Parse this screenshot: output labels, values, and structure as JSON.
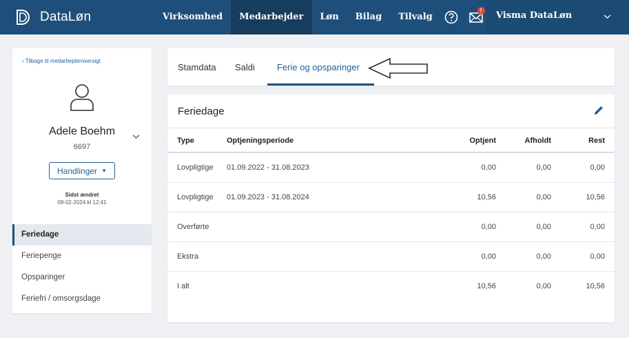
{
  "app": {
    "logo_text": "DataLøn",
    "nav": [
      {
        "label": "Virksomhed"
      },
      {
        "label": "Medarbejder"
      },
      {
        "label": "Løn"
      },
      {
        "label": "Bilag"
      },
      {
        "label": "Tilvalg"
      }
    ],
    "active_nav": "Medarbejder",
    "mail_badge": "!",
    "account_name": "Visma DataLøn"
  },
  "sidebar": {
    "back_link": "Tilbage til medarbejderoversigt",
    "employee_name": "Adele Boehm",
    "employee_number": "6697",
    "actions_label": "Handlinger",
    "changed_label": "Sidst ændret",
    "changed_value": "09-02-2024 kl 12:41",
    "menu": [
      {
        "label": "Feriedage"
      },
      {
        "label": "Feriepenge"
      },
      {
        "label": "Opsparinger"
      },
      {
        "label": "Feriefri / omsorgsdage"
      }
    ],
    "active_menu": "Feriedage"
  },
  "tabs": [
    {
      "label": "Stamdata"
    },
    {
      "label": "Saldi"
    },
    {
      "label": "Ferie og opsparinger"
    }
  ],
  "active_tab": "Ferie og opsparinger",
  "feriedage": {
    "title": "Feriedage",
    "columns": {
      "type": "Type",
      "period": "Optjeningsperiode",
      "optjent": "Optjent",
      "afholdt": "Afholdt",
      "rest": "Rest"
    },
    "rows": [
      {
        "type": "Lovpligtige",
        "period": "01.09.2022 - 31.08.2023",
        "optjent": "0,00",
        "afholdt": "0,00",
        "rest": "0,00"
      },
      {
        "type": "Lovpligtige",
        "period": "01.09.2023 - 31.08.2024",
        "optjent": "10,56",
        "afholdt": "0,00",
        "rest": "10,56"
      },
      {
        "type": "Overførte",
        "period": "",
        "optjent": "0,00",
        "afholdt": "0,00",
        "rest": "0,00"
      },
      {
        "type": "Ekstra",
        "period": "",
        "optjent": "0,00",
        "afholdt": "0,00",
        "rest": "0,00"
      },
      {
        "type": "I alt",
        "period": "",
        "optjent": "10,56",
        "afholdt": "0,00",
        "rest": "10,56"
      }
    ]
  },
  "colors": {
    "topbar": "#1e4f7a",
    "topbar_active": "#163c5e",
    "accent": "#1e5f9a",
    "badge": "#e0463a"
  },
  "icons": {
    "logo": "datalon-logo-icon",
    "help": "help-circle-icon",
    "mail": "mail-icon",
    "settings": "gear-icon",
    "account_chevron": "chevron-down-icon",
    "avatar": "user-avatar-icon",
    "edit": "pencil-icon",
    "annotation": "arrow-left-outline-icon"
  }
}
